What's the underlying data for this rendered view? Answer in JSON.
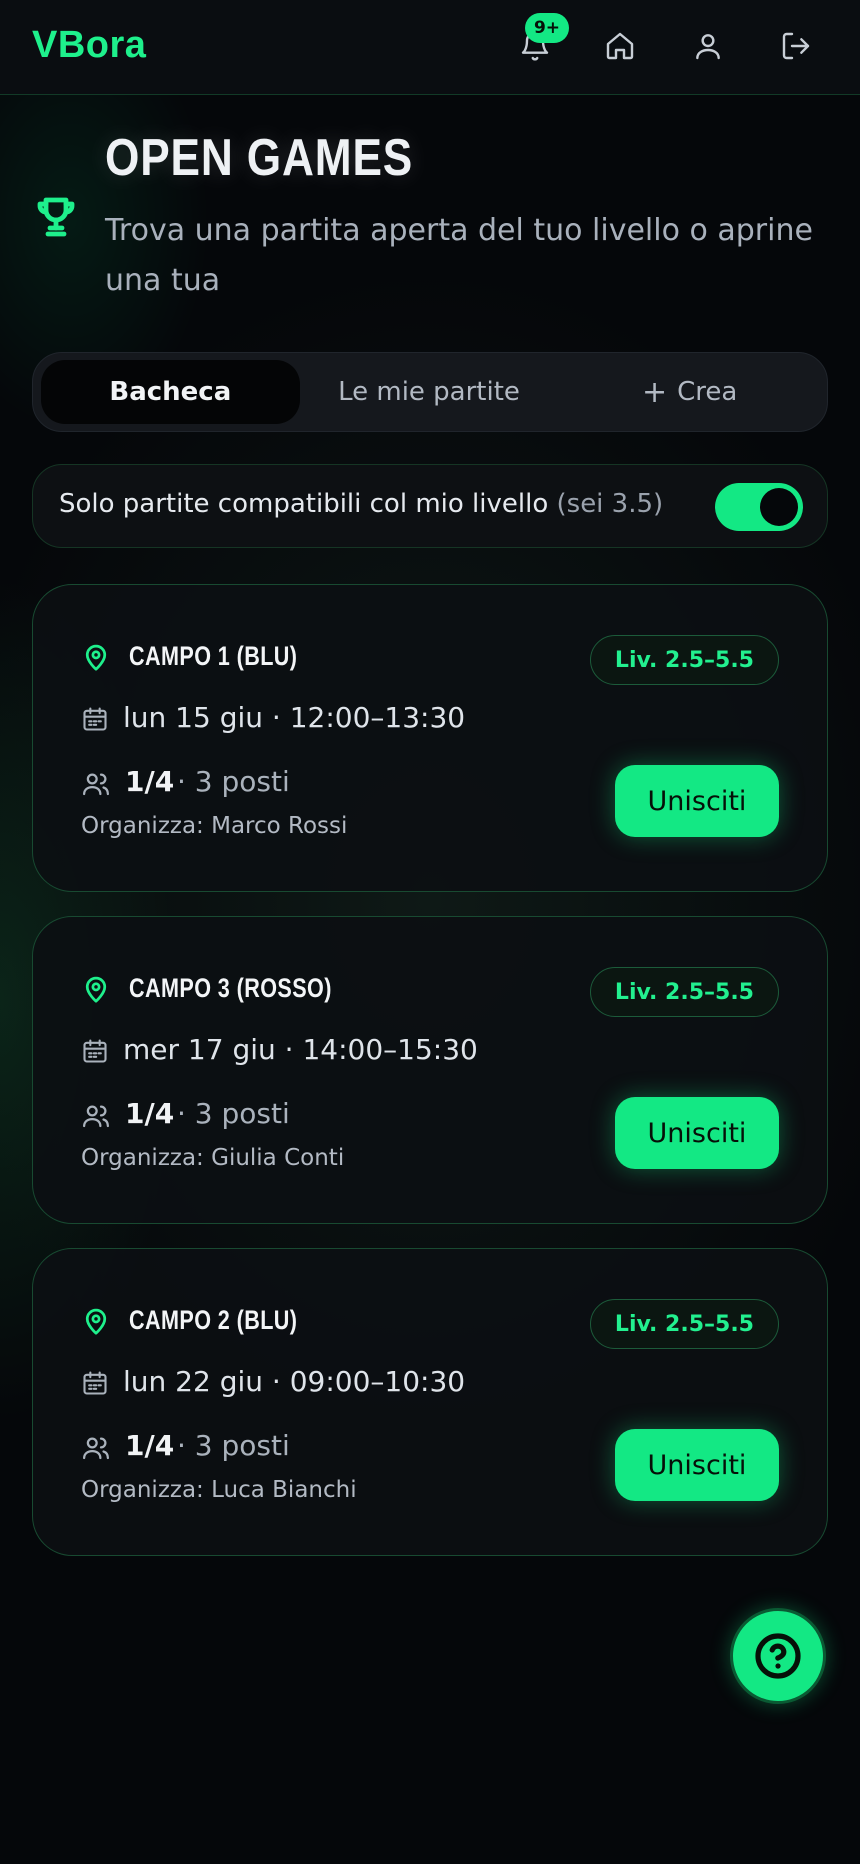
{
  "app": {
    "logo": "VBora"
  },
  "header": {
    "notifications_badge": "9+"
  },
  "page": {
    "title": "OPEN GAMES",
    "subtitle": "Trova una partita aperta del tuo livello o aprine una tua"
  },
  "tabs": [
    {
      "label": "Bacheca",
      "active": true
    },
    {
      "label": "Le mie partite",
      "active": false
    },
    {
      "label": "Crea",
      "active": false
    }
  ],
  "filter": {
    "label": "Solo partite compatibili col mio livello",
    "level_note": "(sei 3.5)",
    "enabled": true
  },
  "games": [
    {
      "court": "CAMPO 1 (BLU)",
      "level": "Liv. 2.5–5.5",
      "when": "lun 15 giu · 12:00–13:30",
      "count": "1/4",
      "slots": "· 3 posti",
      "organizer": "Organizza: Marco Rossi",
      "join_label": "Unisciti"
    },
    {
      "court": "CAMPO 3 (ROSSO)",
      "level": "Liv. 2.5–5.5",
      "when": "mer 17 giu · 14:00–15:30",
      "count": "1/4",
      "slots": "· 3 posti",
      "organizer": "Organizza: Giulia Conti",
      "join_label": "Unisciti"
    },
    {
      "court": "CAMPO 2 (BLU)",
      "level": "Liv. 2.5–5.5",
      "when": "lun 22 giu · 09:00–10:30",
      "count": "1/4",
      "slots": "· 3 posti",
      "organizer": "Organizza: Luca Bianchi",
      "join_label": "Unisciti"
    }
  ],
  "icons": {
    "notifications": "bell-icon",
    "home": "home-icon",
    "profile": "user-icon",
    "logout": "logout-icon",
    "section": "trophy-icon",
    "location": "map-pin-icon",
    "date": "calendar-icon",
    "players": "users-icon",
    "help": "help-circle-icon"
  },
  "colors": {
    "accent": "#13e884",
    "background": "#05070a",
    "card": "#0c0f12"
  }
}
